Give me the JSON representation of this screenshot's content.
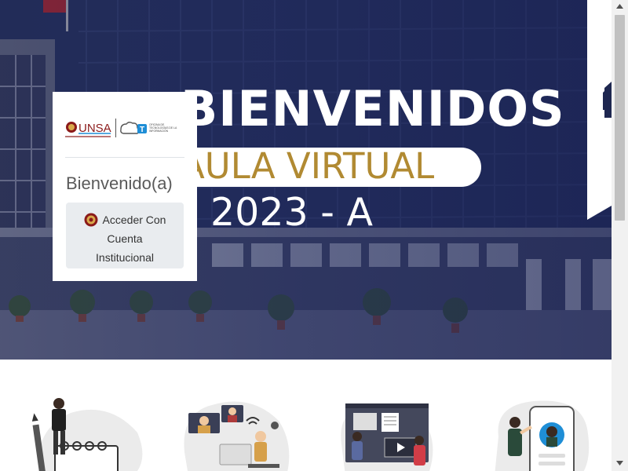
{
  "hero": {
    "title_line1": "BIENVENIDOS",
    "title_line2": "AULA VIRTUAL",
    "title_line3": "2023 - A"
  },
  "login": {
    "welcome": "Bienvenido(a)",
    "sso_line1": "Acceder Con",
    "sso_line2": "Cuenta",
    "sso_line3": "Institucional"
  },
  "logos": {
    "unsa": "UNSA",
    "ti_brand": "T",
    "ti_caption": "OFICINA DE TECNOLOGÍAS DE LA INFORMACIÓN"
  },
  "features": {
    "items": [
      {
        "icon": "person-calendar-illustration"
      },
      {
        "icon": "online-class-illustration"
      },
      {
        "icon": "video-board-illustration"
      },
      {
        "icon": "mobile-profile-illustration"
      }
    ]
  },
  "colors": {
    "hero_navy": "#1e2750",
    "gold": "#b18a32",
    "button_gray": "#e9ecef",
    "unsa_red": "#8b1a1a",
    "ti_blue": "#1f8ed6"
  }
}
